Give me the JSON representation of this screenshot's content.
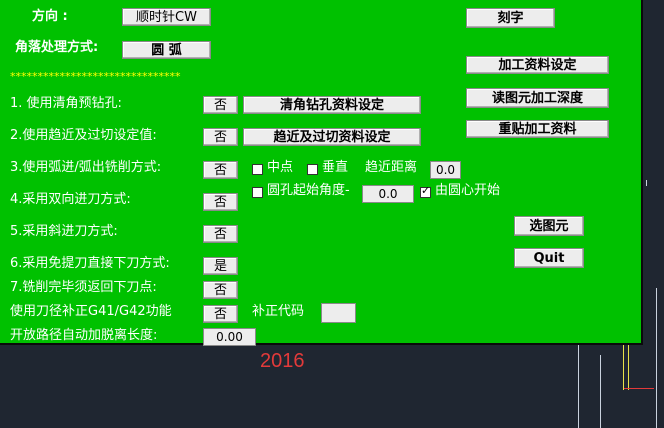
{
  "direction": {
    "label": "方向  :",
    "value": "顺时针CW"
  },
  "corner": {
    "label": "角落处理方式:",
    "value": "圆 弧"
  },
  "divider_stars": "*******************************",
  "rows": [
    {
      "label": "1. 使用清角预钻孔:",
      "toggle": "否",
      "action": "清角钻孔资料设定"
    },
    {
      "label": "2.使用趋近及过切设定值:",
      "toggle": "否",
      "action": "趋近及过切资料设定"
    },
    {
      "label": "3.使用弧进/弧出铣削方式:",
      "toggle": "否"
    },
    {
      "label": "4.采用双向进刀方式:",
      "toggle": "否"
    },
    {
      "label": "5.采用斜进刀方式:",
      "toggle": "否"
    },
    {
      "label": "6.采用免提刀直接下刀方式:",
      "toggle": "是"
    },
    {
      "label": "7.铣削完毕须返回下刀点:",
      "toggle": "否"
    },
    {
      "label": "使用刀径补正G41/G42功能",
      "toggle": "否"
    },
    {
      "label": "开放路径自动加脱离长度:",
      "value": "0.00"
    }
  ],
  "arc_options": {
    "midpoint_label": "中点",
    "perpendicular_label": "垂直",
    "approach_label": "趋近距离",
    "approach_value": "0.0",
    "hole_start_label": "圆孔起始角度-",
    "hole_start_value": "0.0",
    "center_start_label": "由圆心开始",
    "center_start_checked": true
  },
  "comp_code_label": "补正代码",
  "comp_code_value": "",
  "right_buttons": {
    "engrave": "刻字",
    "machining_setup": "加工资料设定",
    "read_depth": "读图元加工深度",
    "reapply": "重贴加工资料",
    "select_entity": "选图元",
    "quit": "Quit"
  },
  "background_year": "2016",
  "colors": {
    "panel": "#00c100",
    "label": "#ffffff",
    "stars": "#ffff00"
  }
}
